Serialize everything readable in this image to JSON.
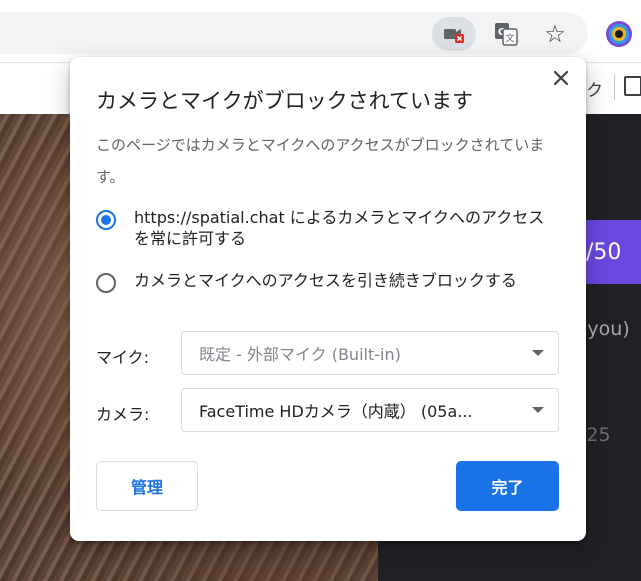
{
  "toolbar": {
    "camera_blocked_icon": "camera-blocked-icon",
    "translate_icon": "translate-icon",
    "star_icon": "star-icon",
    "extension_icon": "extension-icon",
    "star_glyph": "☆"
  },
  "background": {
    "strip_text": "ク",
    "counter": "/50",
    "you_label": "(you)",
    "number": "/25",
    "accent_color": "#6a48e0"
  },
  "dialog": {
    "title": "カメラとマイクがブロックされています",
    "close_glyph": "✕",
    "description": "このページではカメラとマイクへのアクセスがブロックされています。",
    "options": [
      {
        "label": "https://spatial.chat によるカメラとマイクへのアクセスを常に許可する",
        "selected": true
      },
      {
        "label": "カメラとマイクへのアクセスを引き続きブロックする",
        "selected": false
      }
    ],
    "mic": {
      "label": "マイク:",
      "value": "既定 - 外部マイク (Built-in)"
    },
    "camera": {
      "label": "カメラ:",
      "value": "FaceTime HDカメラ（内蔵） (05a..."
    },
    "manage_label": "管理",
    "done_label": "完了",
    "accent_color": "#1a73e8"
  }
}
